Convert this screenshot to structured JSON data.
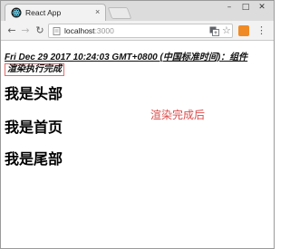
{
  "browser": {
    "tab_title": "React App",
    "tab_close": "×",
    "window_controls": {
      "minimize": "–",
      "maximize": "□",
      "close": "✕"
    },
    "icons": {
      "tab": "react-logo-icon",
      "back": "back-arrow-icon",
      "forward": "forward-arrow-icon",
      "reload": "reload-icon",
      "page": "page-info-icon",
      "translate": "translate-icon",
      "bookmark": "star-icon",
      "extension": "extension-icon",
      "menu": "menu-icon"
    },
    "address": {
      "host": "localhost",
      "port": ":3000"
    },
    "colors": {
      "extension": "#f08a24",
      "url_port": "#999999"
    }
  },
  "page": {
    "date_line": "Fri Dec 29 2017 10:24:03 GMT+0800 (中国标准时间)：组件",
    "render_status": "渲染执行完成",
    "header_text": "我是头部",
    "home_text": "我是首页",
    "footer_text": "我是尾部",
    "after_render_note": "渲染完成后",
    "colors": {
      "note": "#dd4a4a",
      "box_border": "#e26b6b"
    }
  }
}
